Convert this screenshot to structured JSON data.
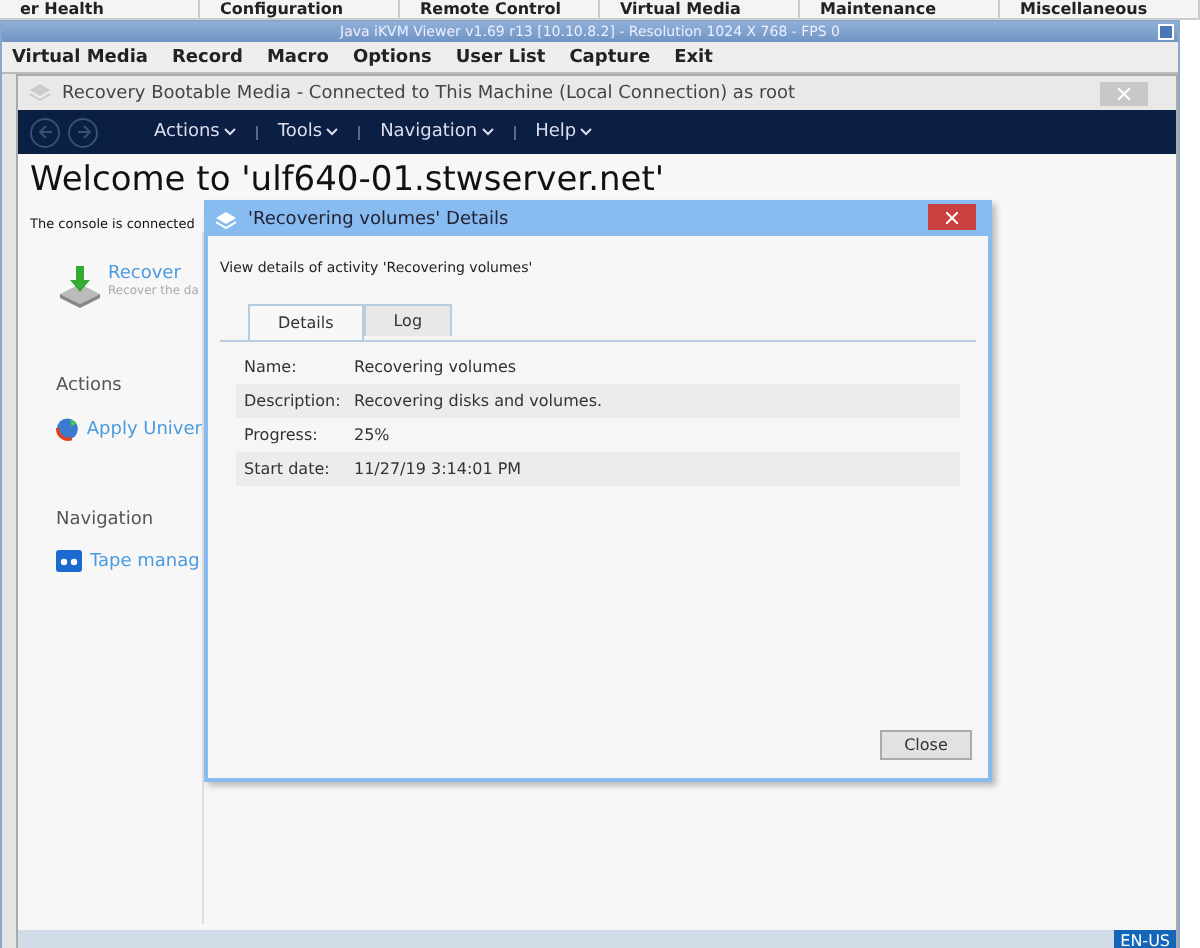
{
  "background_tabs": [
    "er Health",
    "Configuration",
    "Remote Control",
    "Virtual Media",
    "Maintenance",
    "Miscellaneous"
  ],
  "viewer": {
    "title": "Java iKVM Viewer v1.69 r13 [10.10.8.2]  - Resolution 1024 X 768 - FPS 0",
    "menu": [
      "Virtual Media",
      "Record",
      "Macro",
      "Options",
      "User List",
      "Capture",
      "Exit"
    ]
  },
  "app": {
    "title": "Recovery Bootable Media - Connected to This Machine (Local Connection) as root",
    "nav_menu": [
      "Actions",
      "Tools",
      "Navigation",
      "Help"
    ],
    "heading": "Welcome to 'ulf640-01.stwserver.net'",
    "intro": "The console is connected",
    "recover": {
      "title": "Recover",
      "subtitle": "Recover the da"
    },
    "sections": [
      {
        "title": "Actions",
        "item": "Apply Univer",
        "kind": "globe"
      },
      {
        "title": "Navigation",
        "item": "Tape manag",
        "kind": "tape"
      }
    ],
    "locale": "EN-US"
  },
  "dialog": {
    "title": "'Recovering volumes' Details",
    "description": "View details of activity 'Recovering volumes'",
    "tabs": [
      {
        "label": "Details",
        "selected": true
      },
      {
        "label": "Log",
        "selected": false
      }
    ],
    "fields": [
      {
        "label": "Name:",
        "value": "Recovering volumes"
      },
      {
        "label": "Description:",
        "value": "Recovering disks and volumes."
      },
      {
        "label": "Progress:",
        "value": "25%"
      },
      {
        "label": "Start date:",
        "value": "11/27/19 3:14:01 PM"
      }
    ],
    "button": "Close"
  }
}
